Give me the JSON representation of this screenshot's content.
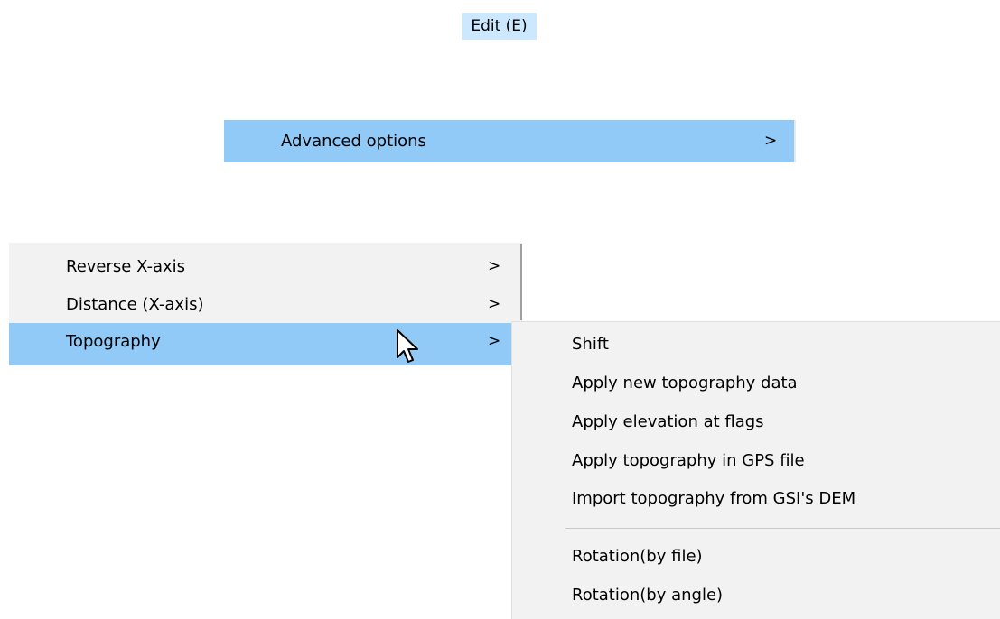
{
  "menubar": {
    "edit_label": "Edit (E)"
  },
  "advanced_menu": {
    "label": "Advanced options",
    "arrow": ">"
  },
  "submenu": {
    "items": [
      {
        "label": "Reverse X-axis",
        "arrow": ">"
      },
      {
        "label": "Distance (X-axis)",
        "arrow": ">"
      },
      {
        "label": "Topography",
        "arrow": ">"
      }
    ]
  },
  "topography_flyout": {
    "items": [
      {
        "label": "Shift"
      },
      {
        "label": "Apply new topography data"
      },
      {
        "label": "Apply elevation at flags"
      },
      {
        "label": "Apply topography in GPS file"
      },
      {
        "label": "Import topography from GSI's DEM"
      },
      {
        "label": "Rotation(by file)"
      },
      {
        "label": "Rotation(by angle)"
      }
    ]
  },
  "colors": {
    "highlight": "#91c9f7",
    "menubar_highlight": "#cce8ff",
    "menu_background": "#f2f2f2"
  },
  "icons": {
    "cursor": "pointer-cursor-icon"
  }
}
